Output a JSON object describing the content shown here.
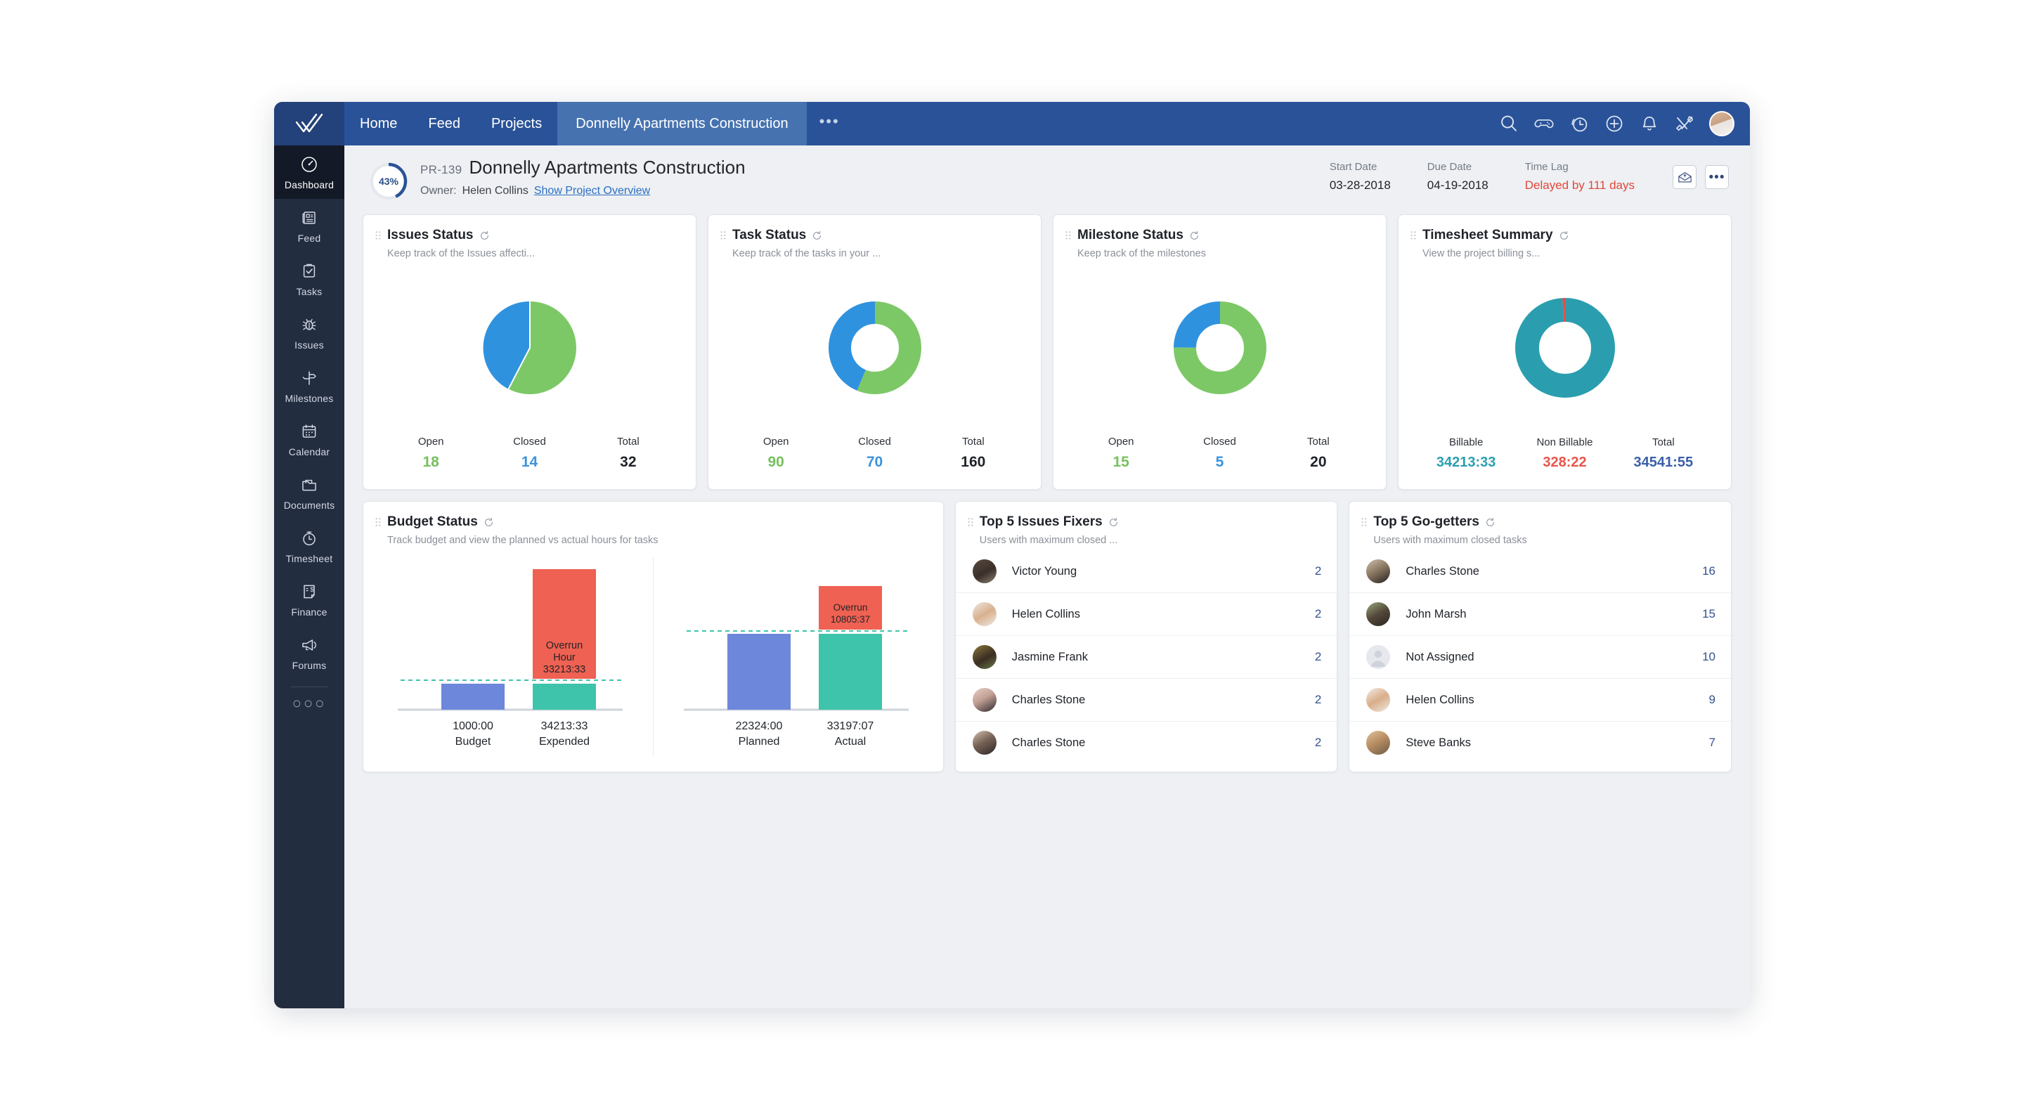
{
  "topnav": {
    "logo": "double-check-logo",
    "links": [
      {
        "label": "Home",
        "active": false
      },
      {
        "label": "Feed",
        "active": false
      },
      {
        "label": "Projects",
        "active": false
      },
      {
        "label": "Donnelly Apartments Construction",
        "active": true
      }
    ],
    "more": "•••",
    "icons": [
      "search-icon",
      "gamepad-icon",
      "clock-icon",
      "add-circle-icon",
      "bell-icon",
      "tools-icon"
    ],
    "avatar": "user-avatar"
  },
  "sidebar": {
    "items": [
      {
        "label": "Dashboard",
        "icon": "speedometer-icon",
        "active": true
      },
      {
        "label": "Feed",
        "icon": "news-icon",
        "active": false
      },
      {
        "label": "Tasks",
        "icon": "clipboard-check-icon",
        "active": false
      },
      {
        "label": "Issues",
        "icon": "bug-icon",
        "active": false
      },
      {
        "label": "Milestones",
        "icon": "signpost-icon",
        "active": false
      },
      {
        "label": "Calendar",
        "icon": "calendar-icon",
        "active": false
      },
      {
        "label": "Documents",
        "icon": "folder-icon",
        "active": false
      },
      {
        "label": "Timesheet",
        "icon": "stopwatch-icon",
        "active": false
      },
      {
        "label": "Finance",
        "icon": "invoice-dollar-icon",
        "active": false
      },
      {
        "label": "Forums",
        "icon": "megaphone-icon",
        "active": false
      }
    ],
    "more": "○○○"
  },
  "project_header": {
    "progress_percent": "43%",
    "progress_value": 43,
    "code": "PR-139",
    "title": "Donnelly Apartments Construction",
    "owner_label": "Owner:",
    "owner_name": "Helen Collins",
    "overview_link": "Show Project Overview",
    "dates": [
      {
        "label": "Start Date",
        "value": "03-28-2018",
        "danger": false
      },
      {
        "label": "Due Date",
        "value": "04-19-2018",
        "danger": false
      },
      {
        "label": "Time Lag",
        "value": "Delayed by 111 days",
        "danger": true
      }
    ],
    "actions": [
      {
        "name": "open-envelope-button",
        "glyph": "envelope"
      },
      {
        "name": "more-options-button",
        "glyph": "•••"
      }
    ]
  },
  "cards": {
    "issues": {
      "title": "Issues Status",
      "desc": "Keep track of the Issues affecti...",
      "stats": [
        {
          "label": "Open",
          "value": "18",
          "color": "green"
        },
        {
          "label": "Closed",
          "value": "14",
          "color": "blue"
        },
        {
          "label": "Total",
          "value": "32",
          "color": "dark"
        }
      ]
    },
    "task": {
      "title": "Task Status",
      "desc": "Keep track of the tasks in your ...",
      "stats": [
        {
          "label": "Open",
          "value": "90",
          "color": "green"
        },
        {
          "label": "Closed",
          "value": "70",
          "color": "blue"
        },
        {
          "label": "Total",
          "value": "160",
          "color": "dark"
        }
      ]
    },
    "milestone": {
      "title": "Milestone Status",
      "desc": "Keep track of the milestones",
      "stats": [
        {
          "label": "Open",
          "value": "15",
          "color": "green"
        },
        {
          "label": "Closed",
          "value": "5",
          "color": "blue"
        },
        {
          "label": "Total",
          "value": "20",
          "color": "dark"
        }
      ]
    },
    "timesheet": {
      "title": "Timesheet Summary",
      "desc": "View the project billing s...",
      "stats": [
        {
          "label": "Billable",
          "value": "34213:33",
          "color": "teal"
        },
        {
          "label": "Non Billable",
          "value": "328:22",
          "color": "red"
        },
        {
          "label": "Total",
          "value": "34541:55",
          "color": "navy"
        }
      ]
    },
    "budget": {
      "title": "Budget Status",
      "desc": "Track budget and view the planned vs actual hours for tasks"
    },
    "fixers": {
      "title": "Top 5 Issues Fixers",
      "desc": "Users with maximum closed ...",
      "items": [
        {
          "name": "Victor Young",
          "count": "2",
          "avatar": "av-a"
        },
        {
          "name": "Helen Collins",
          "count": "2",
          "avatar": "av-b"
        },
        {
          "name": "Jasmine Frank",
          "count": "2",
          "avatar": "av-c"
        },
        {
          "name": "Charles Stone",
          "count": "2",
          "avatar": "av-d"
        },
        {
          "name": "Charles Stone",
          "count": "2",
          "avatar": "av-e"
        }
      ]
    },
    "gogetters": {
      "title": "Top 5 Go-getters",
      "desc": "Users with maximum closed tasks",
      "items": [
        {
          "name": "Charles Stone",
          "count": "16",
          "avatar": "av-f"
        },
        {
          "name": "John Marsh",
          "count": "15",
          "avatar": "av-g"
        },
        {
          "name": "Not Assigned",
          "count": "10",
          "avatar": "av-h"
        },
        {
          "name": "Helen Collins",
          "count": "9",
          "avatar": "av-i"
        },
        {
          "name": "Steve Banks",
          "count": "7",
          "avatar": "av-j"
        }
      ]
    }
  },
  "chart_data": [
    {
      "type": "pie",
      "title": "Issues Status",
      "categories": [
        "Open",
        "Closed"
      ],
      "values": [
        18,
        14
      ],
      "colors": [
        "#7dc866",
        "#2f92df"
      ],
      "legend": "below",
      "hole": 0
    },
    {
      "type": "pie",
      "title": "Task Status",
      "categories": [
        "Open",
        "Closed"
      ],
      "values": [
        90,
        70
      ],
      "colors": [
        "#7dc866",
        "#2f92df"
      ],
      "legend": "below",
      "hole": 0.6
    },
    {
      "type": "pie",
      "title": "Milestone Status",
      "categories": [
        "Open",
        "Closed"
      ],
      "values": [
        15,
        5
      ],
      "colors": [
        "#7dc866",
        "#2f92df"
      ],
      "legend": "below",
      "hole": 0.6
    },
    {
      "type": "pie",
      "title": "Timesheet Summary",
      "categories": [
        "Billable",
        "Non Billable"
      ],
      "values": [
        34213.55,
        328.37
      ],
      "colors": [
        "#2a9eae",
        "#ef4a42"
      ],
      "legend": "below",
      "hole": 0.62
    },
    {
      "type": "bar",
      "title": "Budget Status — Budget vs Expended",
      "categories": [
        "Budget",
        "Expended"
      ],
      "value_labels": [
        "1000:00",
        "34213:33"
      ],
      "values": [
        1000.0,
        34213.55
      ],
      "base_values": [
        1000.0,
        1000.0
      ],
      "overrun_value": 33213.55,
      "overrun_label": [
        "Overrun",
        "Hour",
        "33213:33"
      ],
      "colors": [
        "#6d87db",
        "#3ec4ab"
      ],
      "overrun_color": "#ef6152",
      "threshold_line": true
    },
    {
      "type": "bar",
      "title": "Budget Status — Planned vs Actual",
      "categories": [
        "Planned",
        "Actual"
      ],
      "value_labels": [
        "22324:00",
        "33197:07"
      ],
      "values": [
        22324.0,
        33197.12
      ],
      "base_values": [
        22324.0,
        22324.0
      ],
      "overrun_value": 10805.62,
      "overrun_label": [
        "Overrun",
        "10805:37"
      ],
      "colors": [
        "#6d87db",
        "#3ec4ab"
      ],
      "overrun_color": "#ef6152",
      "threshold_line": true
    }
  ],
  "colors": {
    "brand_blue": "#2a5298",
    "sidebar": "#232d40",
    "green": "#7dc866",
    "blue": "#2f92df",
    "teal": "#2a9eae",
    "red": "#ef4a42",
    "bar_blue": "#6d87db",
    "bar_teal": "#3ec4ab",
    "overrun": "#ef6152"
  }
}
